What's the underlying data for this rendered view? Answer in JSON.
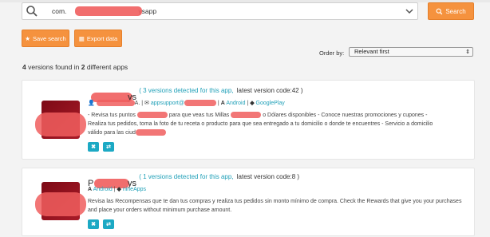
{
  "search": {
    "value_prefix": "com.",
    "value_suffix": "ysapp",
    "button_label": "Search"
  },
  "toolbar": {
    "save_label": "Save search",
    "export_label": "Export data"
  },
  "order": {
    "label": "Order by:",
    "selected": "Relevant first"
  },
  "summary": {
    "versions_count": "4",
    "text_mid": " versions found in ",
    "apps_count": "2",
    "text_end": " different apps"
  },
  "apps": [
    {
      "name_suffix": "ys",
      "versions_link": "( 3 versions detected for this app,",
      "latest": "latest version code:42 )",
      "dev_suffix": "A.",
      "email_prefix": "appsupport@",
      "platform": "Android",
      "store": "GooglePlay",
      "desc_1": "- Revisa tus puntos",
      "desc_2": "para que veas tus Millas",
      "desc_3": "o Dólares disponibles - Conoce nuestras promociones y cupones -",
      "desc_4": "Realiza tus pedidos, toma la foto de tu receta o producto para que sea entregado a tu domicilio o donde te encuentres - Servicio a domicilio",
      "desc_5": "válido para las ciud"
    },
    {
      "name_prefix": "P",
      "name_suffix": "ys",
      "versions_link": "( 1 versions detected for this app,",
      "latest": "latest version code:8 )",
      "platform": "Android",
      "store": "nineApps",
      "desc": "Revisa las Recompensas que te dan tus compras y realiza tus pedidos sin monto mínimo de compra. Check the Rewards that give you your purchases and place your orders without minimum purchase amount."
    }
  ],
  "colors": {
    "accent": "#f5923e",
    "teal": "#1ca9c4",
    "link": "#20a0b8"
  }
}
